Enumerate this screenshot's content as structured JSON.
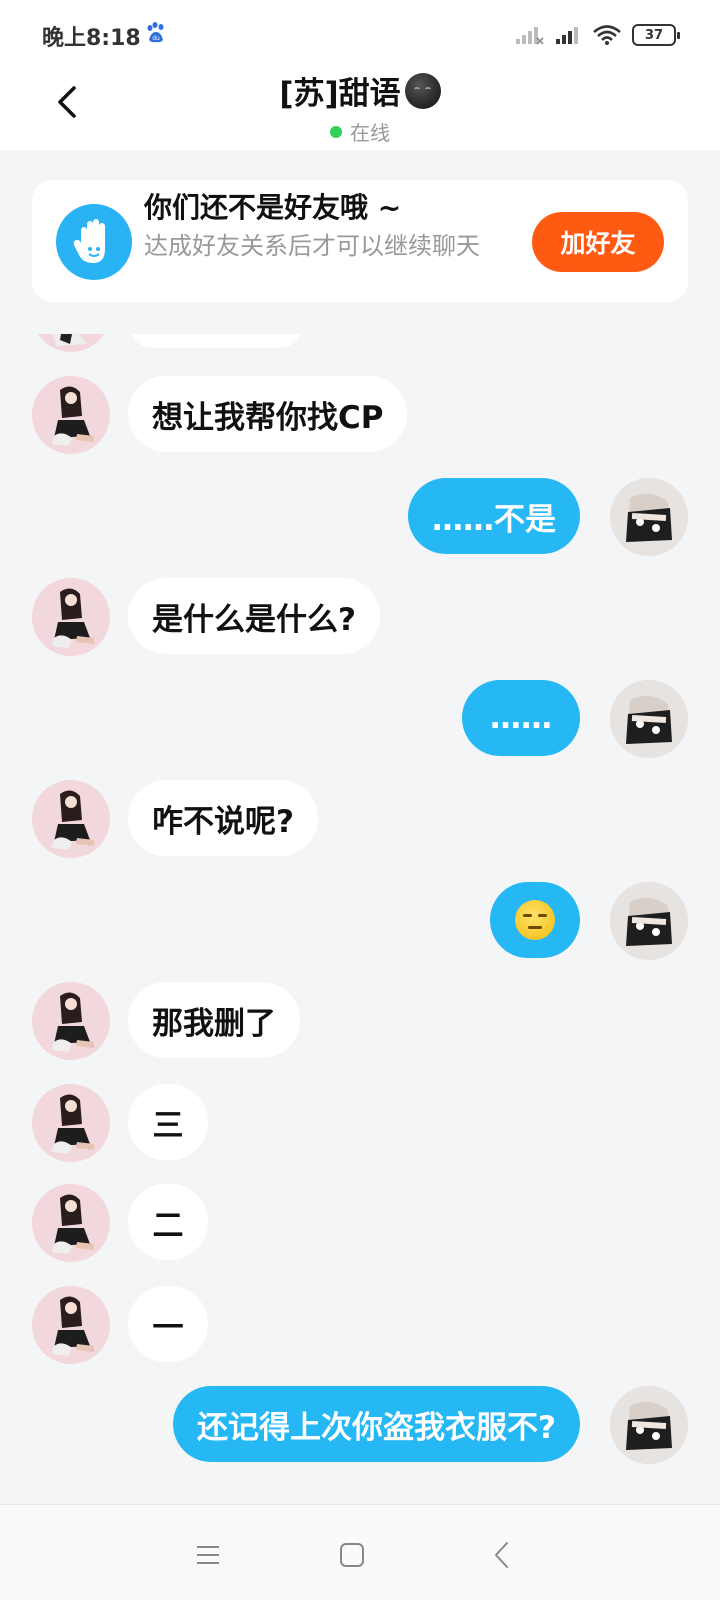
{
  "status_bar": {
    "time": "晚上8:18",
    "battery": "37",
    "icons": [
      "baidu-icon",
      "signal-icon",
      "signal-icon",
      "wifi-icon",
      "battery-icon"
    ]
  },
  "header": {
    "title": "[苏]甜语",
    "status": "在线",
    "status_color": "#2fd159"
  },
  "friend_card": {
    "title": "你们还不是好友哦 ~",
    "description": "达成好友关系后才可以继续聊天",
    "button_label": "加好友",
    "button_color": "#ff5a12",
    "icon": "hand-icon"
  },
  "messages": [
    {
      "from": "other",
      "text": "想让我帮你找CP"
    },
    {
      "from": "self",
      "text": "……不是"
    },
    {
      "from": "other",
      "text": "是什么是什么?"
    },
    {
      "from": "self",
      "text": "……"
    },
    {
      "from": "other",
      "text": "咋不说呢?"
    },
    {
      "from": "self",
      "text": "",
      "emoji": "expressionless-face-icon"
    },
    {
      "from": "other",
      "text": "那我删了"
    },
    {
      "from": "other",
      "text": "三"
    },
    {
      "from": "other",
      "text": "二"
    },
    {
      "from": "other",
      "text": "一"
    },
    {
      "from": "self",
      "text": "还记得上次你盗我衣服不?"
    }
  ],
  "colors": {
    "self_bubble": "#26b7f5",
    "other_bubble": "#ffffff",
    "background": "#f4f5f7"
  },
  "nav_bar": {
    "icons": [
      "menu-icon",
      "home-icon",
      "back-icon"
    ]
  }
}
